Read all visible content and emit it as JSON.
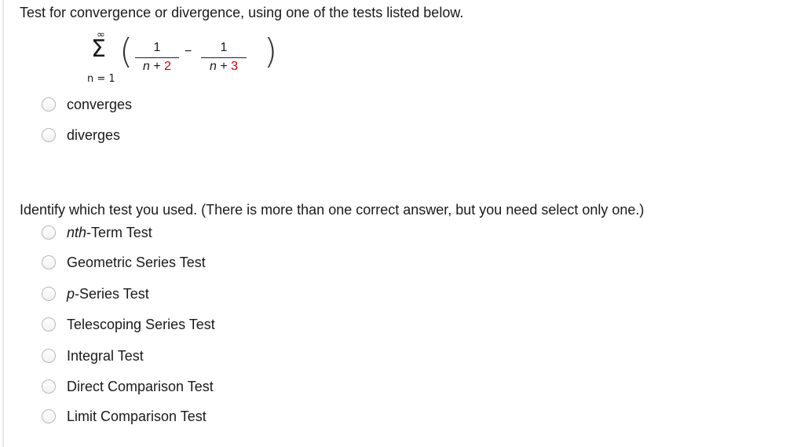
{
  "question": {
    "prompt": "Test for convergence or divergence, using one of the tests listed below."
  },
  "formula": {
    "sigma": "Σ",
    "upper_limit": "∞",
    "lower_limit": "n = 1",
    "left_paren": "(",
    "right_paren": ")",
    "term1_numerator": "1",
    "term1_denominator_var": "n",
    "term1_denominator_op": " + ",
    "term1_denominator_value": "2",
    "operator": "−",
    "term2_numerator": "1",
    "term2_denominator_var": "n",
    "term2_denominator_op": " + ",
    "term2_denominator_value": "3",
    "highlight_color": "#d40000"
  },
  "convergence_options": [
    {
      "label": "converges",
      "selected": false
    },
    {
      "label": "diverges",
      "selected": false
    }
  ],
  "identify": {
    "prompt": "Identify which test you used. (There is more than one correct answer, but you need select only one.)"
  },
  "test_options": [
    {
      "label_prefix": "nth",
      "label_rest": "-Term Test",
      "selected": false
    },
    {
      "label": "Geometric Series Test",
      "selected": false
    },
    {
      "label_prefix": "p",
      "label_rest": "-Series Test",
      "selected": false
    },
    {
      "label": "Telescoping Series Test",
      "selected": false
    },
    {
      "label": "Integral Test",
      "selected": false
    },
    {
      "label": "Direct Comparison Test",
      "selected": false
    },
    {
      "label": "Limit Comparison Test",
      "selected": false
    }
  ]
}
